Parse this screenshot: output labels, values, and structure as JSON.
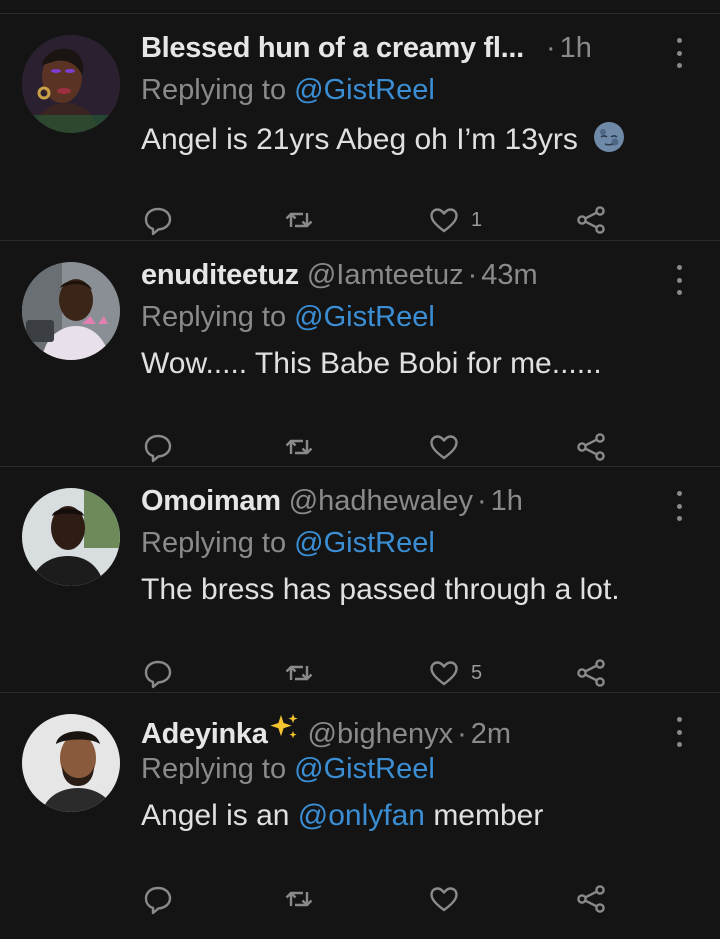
{
  "reply_prefix": "Replying to",
  "tweets": [
    {
      "name": "Blessed hun of a creamy fl...",
      "handle": "",
      "separator": "·",
      "time": "1h",
      "reply_to": "@GistReel",
      "text": "Angel is 21yrs Abeg oh I’m 13yrs",
      "text_mention": "",
      "text_suffix": "",
      "emoji": "moon-face-icon",
      "likes": "1"
    },
    {
      "name": "enuditeetuz",
      "handle": "@Iamteetuz",
      "separator": "·",
      "time": "43m",
      "reply_to": "@GistReel",
      "text": "Wow..... This Babe Bobi for me......",
      "text_mention": "",
      "text_suffix": "",
      "emoji": "",
      "likes": ""
    },
    {
      "name": "Omoimam",
      "handle": "@hadhewaley",
      "separator": "·",
      "time": "1h",
      "reply_to": "@GistReel",
      "text": "The bress has passed through a lot.",
      "text_mention": "",
      "text_suffix": "",
      "emoji": "",
      "likes": "5"
    },
    {
      "name": "Adeyinka",
      "name_emoji": "sparkles-icon",
      "handle": "@bighenyx",
      "separator": "·",
      "time": "2m",
      "reply_to": "@GistReel",
      "text": "Angel is an ",
      "text_mention": "@onlyfan",
      "text_suffix": " member",
      "emoji": "",
      "likes": ""
    }
  ],
  "colors": {
    "background": "#141414",
    "mention": "#3b8ed4",
    "muted": "#8a8a8a",
    "text": "#e0e0e0"
  }
}
